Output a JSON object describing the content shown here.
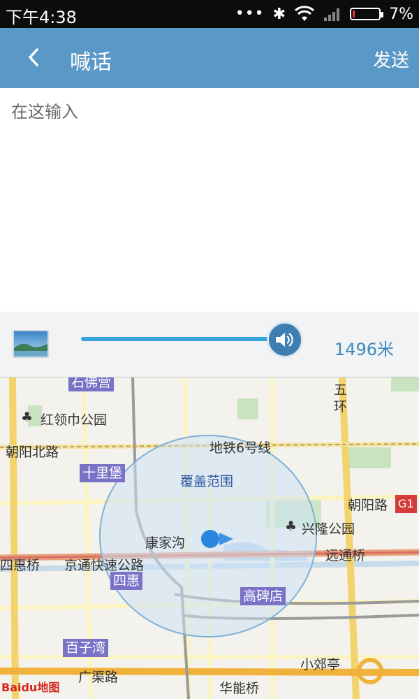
{
  "status_bar": {
    "time": "下午4:38",
    "dots": "•••",
    "bluetooth_icon": "✱",
    "battery_percent": "7%"
  },
  "header": {
    "back_icon": "chevron-left-icon",
    "title": "喊话",
    "send_label": "发送"
  },
  "message_input": {
    "value": "",
    "placeholder": "在这输入"
  },
  "range_slider": {
    "value": 1496,
    "unit": "米",
    "display": "1496米",
    "fill_fraction": 0.93
  },
  "map": {
    "coverage_label": "覆盖范围",
    "labels": {
      "shifo": "石佛营",
      "hongling_park": "红领巾公园",
      "chaoyang_north": "朝阳北路",
      "shilibao": "十里堡",
      "subway6": "地铁6号线",
      "wuhuan": "五环",
      "chaoyang_road": "朝阳路",
      "g1": "G1",
      "xinglong_park": "兴隆公园",
      "kangjiagou": "康家沟",
      "huiqiao": "四惠桥",
      "jingtong": "京通快速公路",
      "yuantong": "远通桥",
      "sihui": "四惠",
      "gaobeidian": "高碑店",
      "baiziwan": "百子湾",
      "xiaojiaoting": "小郊亭",
      "guangqu": "广渠路",
      "huaneng": "华能桥",
      "baidu_logo": "Baidu地图"
    }
  },
  "colors": {
    "header_bg": "#5a98c7",
    "slider_fill": "#37a4dd",
    "distance_text": "#3f88bd"
  }
}
